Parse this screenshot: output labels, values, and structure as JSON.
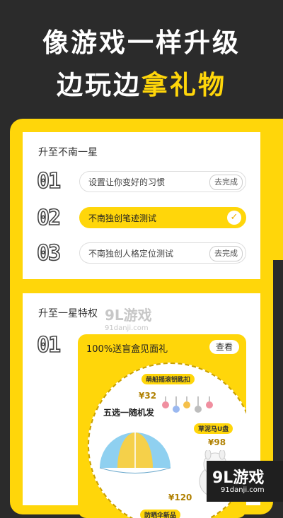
{
  "hero": {
    "line1": "像游戏一样升级",
    "line2_a": "边玩边",
    "line2_b": "拿礼物"
  },
  "level_card": {
    "title": "升至不南一星",
    "tasks": [
      {
        "num": "01",
        "label": "设置让你变好的习惯",
        "action": "去完成",
        "done": false
      },
      {
        "num": "02",
        "label": "不南独创笔迹测试",
        "action": "",
        "done": true
      },
      {
        "num": "03",
        "label": "不南独创人格定位测试",
        "action": "去完成",
        "done": false
      }
    ]
  },
  "privilege_card": {
    "title": "升至一星特权",
    "num": "01",
    "gift_title": "100%送盲盒见面礼",
    "view_label": "查看",
    "keychain_tag": "萌船摇滚钥匙扣",
    "price_1": "¥32",
    "pick_label": "五选一随机发",
    "udisk_tag": "草泥马U盘",
    "price_2": "¥98",
    "price_3": "¥120",
    "umbrella_tag": "防晒伞新品"
  },
  "watermark": {
    "brand": "9L游戏",
    "url": "91danji.com"
  },
  "colors": {
    "accent": "#ffd60a",
    "background": "#2b2b2b"
  },
  "icons": {
    "check": "check-icon"
  }
}
